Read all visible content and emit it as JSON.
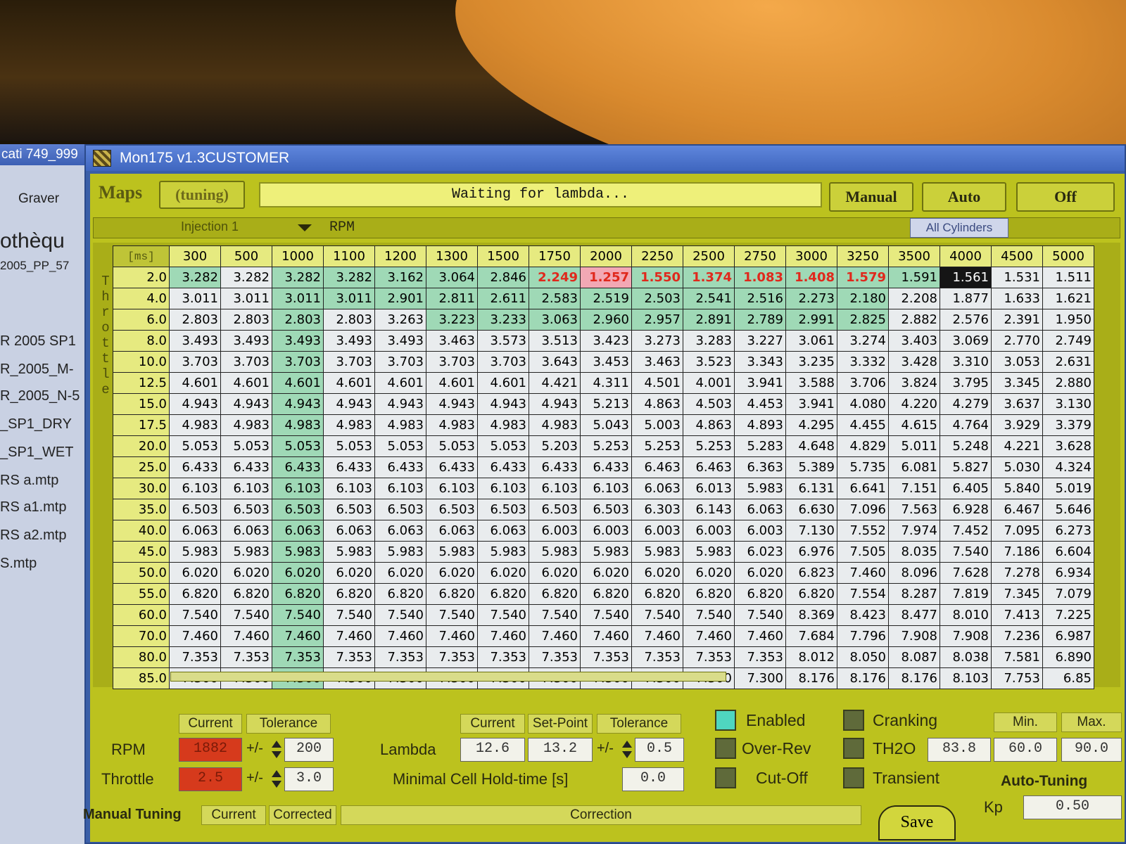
{
  "desktop": {
    "window_title": "cati 749_999",
    "items": [
      "Graver",
      "othèqu",
      "2005_PP_57",
      "R 2005 SP1",
      "R_2005_M-",
      "R_2005_N-5",
      "_SP1_DRY",
      "_SP1_WET",
      "RS a.mtp",
      "RS a1.mtp",
      "RS a2.mtp",
      "S.mtp"
    ]
  },
  "window": {
    "title": "Mon175 v1.3CUSTOMER"
  },
  "toolbar": {
    "maps_label": "Maps",
    "tuning_label": "(tuning)",
    "status_text": "Waiting for lambda...",
    "manual_label": "Manual",
    "auto_label": "Auto",
    "off_label": "Off"
  },
  "selector": {
    "injection_value": "Injection 1",
    "x_axis_label": "RPM",
    "cylinders_value": "All Cylinders"
  },
  "map": {
    "corner_label": "[ms]",
    "y_axis_label": "Throttle",
    "columns": [
      "300",
      "500",
      "1000",
      "1100",
      "1200",
      "1300",
      "1500",
      "1750",
      "2000",
      "2250",
      "2500",
      "2750",
      "3000",
      "3250",
      "3500",
      "4000",
      "4500",
      "5000"
    ],
    "rows": [
      {
        "label": "2.0",
        "values": [
          "3.282",
          "3.282",
          "3.282",
          "3.282",
          "3.162",
          "3.064",
          "2.846",
          "2.249",
          "1.257",
          "1.550",
          "1.374",
          "1.083",
          "1.408",
          "1.579",
          "1.591",
          "1.561",
          "1.531",
          "1.511"
        ]
      },
      {
        "label": "4.0",
        "values": [
          "3.011",
          "3.011",
          "3.011",
          "3.011",
          "2.901",
          "2.811",
          "2.611",
          "2.583",
          "2.519",
          "2.503",
          "2.541",
          "2.516",
          "2.273",
          "2.180",
          "2.208",
          "1.877",
          "1.633",
          "1.621"
        ]
      },
      {
        "label": "6.0",
        "values": [
          "2.803",
          "2.803",
          "2.803",
          "2.803",
          "3.263",
          "3.223",
          "3.233",
          "3.063",
          "2.960",
          "2.957",
          "2.891",
          "2.789",
          "2.991",
          "2.825",
          "2.882",
          "2.576",
          "2.391",
          "1.950"
        ]
      },
      {
        "label": "8.0",
        "values": [
          "3.493",
          "3.493",
          "3.493",
          "3.493",
          "3.493",
          "3.463",
          "3.573",
          "3.513",
          "3.423",
          "3.273",
          "3.283",
          "3.227",
          "3.061",
          "3.274",
          "3.403",
          "3.069",
          "2.770",
          "2.749"
        ]
      },
      {
        "label": "10.0",
        "values": [
          "3.703",
          "3.703",
          "3.703",
          "3.703",
          "3.703",
          "3.703",
          "3.703",
          "3.643",
          "3.453",
          "3.463",
          "3.523",
          "3.343",
          "3.235",
          "3.332",
          "3.428",
          "3.310",
          "3.053",
          "2.631"
        ]
      },
      {
        "label": "12.5",
        "values": [
          "4.601",
          "4.601",
          "4.601",
          "4.601",
          "4.601",
          "4.601",
          "4.601",
          "4.421",
          "4.311",
          "4.501",
          "4.001",
          "3.941",
          "3.588",
          "3.706",
          "3.824",
          "3.795",
          "3.345",
          "2.880"
        ]
      },
      {
        "label": "15.0",
        "values": [
          "4.943",
          "4.943",
          "4.943",
          "4.943",
          "4.943",
          "4.943",
          "4.943",
          "4.943",
          "5.213",
          "4.863",
          "4.503",
          "4.453",
          "3.941",
          "4.080",
          "4.220",
          "4.279",
          "3.637",
          "3.130"
        ]
      },
      {
        "label": "17.5",
        "values": [
          "4.983",
          "4.983",
          "4.983",
          "4.983",
          "4.983",
          "4.983",
          "4.983",
          "4.983",
          "5.043",
          "5.003",
          "4.863",
          "4.893",
          "4.295",
          "4.455",
          "4.615",
          "4.764",
          "3.929",
          "3.379"
        ]
      },
      {
        "label": "20.0",
        "values": [
          "5.053",
          "5.053",
          "5.053",
          "5.053",
          "5.053",
          "5.053",
          "5.053",
          "5.203",
          "5.253",
          "5.253",
          "5.253",
          "5.283",
          "4.648",
          "4.829",
          "5.011",
          "5.248",
          "4.221",
          "3.628"
        ]
      },
      {
        "label": "25.0",
        "values": [
          "6.433",
          "6.433",
          "6.433",
          "6.433",
          "6.433",
          "6.433",
          "6.433",
          "6.433",
          "6.433",
          "6.463",
          "6.463",
          "6.363",
          "5.389",
          "5.735",
          "6.081",
          "5.827",
          "5.030",
          "4.324"
        ]
      },
      {
        "label": "30.0",
        "values": [
          "6.103",
          "6.103",
          "6.103",
          "6.103",
          "6.103",
          "6.103",
          "6.103",
          "6.103",
          "6.103",
          "6.063",
          "6.013",
          "5.983",
          "6.131",
          "6.641",
          "7.151",
          "6.405",
          "5.840",
          "5.019"
        ]
      },
      {
        "label": "35.0",
        "values": [
          "6.503",
          "6.503",
          "6.503",
          "6.503",
          "6.503",
          "6.503",
          "6.503",
          "6.503",
          "6.503",
          "6.303",
          "6.143",
          "6.063",
          "6.630",
          "7.096",
          "7.563",
          "6.928",
          "6.467",
          "5.646"
        ]
      },
      {
        "label": "40.0",
        "values": [
          "6.063",
          "6.063",
          "6.063",
          "6.063",
          "6.063",
          "6.063",
          "6.063",
          "6.003",
          "6.003",
          "6.003",
          "6.003",
          "6.003",
          "7.130",
          "7.552",
          "7.974",
          "7.452",
          "7.095",
          "6.273"
        ]
      },
      {
        "label": "45.0",
        "values": [
          "5.983",
          "5.983",
          "5.983",
          "5.983",
          "5.983",
          "5.983",
          "5.983",
          "5.983",
          "5.983",
          "5.983",
          "5.983",
          "6.023",
          "6.976",
          "7.505",
          "8.035",
          "7.540",
          "7.186",
          "6.604"
        ]
      },
      {
        "label": "50.0",
        "values": [
          "6.020",
          "6.020",
          "6.020",
          "6.020",
          "6.020",
          "6.020",
          "6.020",
          "6.020",
          "6.020",
          "6.020",
          "6.020",
          "6.020",
          "6.823",
          "7.460",
          "8.096",
          "7.628",
          "7.278",
          "6.934"
        ]
      },
      {
        "label": "55.0",
        "values": [
          "6.820",
          "6.820",
          "6.820",
          "6.820",
          "6.820",
          "6.820",
          "6.820",
          "6.820",
          "6.820",
          "6.820",
          "6.820",
          "6.820",
          "6.820",
          "7.554",
          "8.287",
          "7.819",
          "7.345",
          "7.079"
        ]
      },
      {
        "label": "60.0",
        "values": [
          "7.540",
          "7.540",
          "7.540",
          "7.540",
          "7.540",
          "7.540",
          "7.540",
          "7.540",
          "7.540",
          "7.540",
          "7.540",
          "7.540",
          "8.369",
          "8.423",
          "8.477",
          "8.010",
          "7.413",
          "7.225"
        ]
      },
      {
        "label": "70.0",
        "values": [
          "7.460",
          "7.460",
          "7.460",
          "7.460",
          "7.460",
          "7.460",
          "7.460",
          "7.460",
          "7.460",
          "7.460",
          "7.460",
          "7.460",
          "7.684",
          "7.796",
          "7.908",
          "7.908",
          "7.236",
          "6.987"
        ]
      },
      {
        "label": "80.0",
        "values": [
          "7.353",
          "7.353",
          "7.353",
          "7.353",
          "7.353",
          "7.353",
          "7.353",
          "7.353",
          "7.353",
          "7.353",
          "7.353",
          "7.353",
          "8.012",
          "8.050",
          "8.087",
          "8.038",
          "7.581",
          "6.890"
        ]
      },
      {
        "label": "85.0",
        "values": [
          "7.300",
          "7.300",
          "7.300",
          "7.300",
          "7.300",
          "7.300",
          "7.300",
          "7.300",
          "7.300",
          "7.300",
          "7.300",
          "7.300",
          "8.176",
          "8.176",
          "8.176",
          "8.103",
          "7.753",
          "6.85"
        ]
      }
    ],
    "highlight": {
      "selected_cell": [
        0,
        15
      ],
      "red_text_cells": [
        [
          0,
          7
        ],
        [
          0,
          8
        ],
        [
          0,
          9
        ],
        [
          0,
          10
        ],
        [
          0,
          11
        ],
        [
          0,
          12
        ],
        [
          0,
          13
        ]
      ],
      "pink_cells": [
        [
          0,
          8
        ]
      ],
      "green_cells": [
        [
          0,
          0
        ],
        [
          0,
          2
        ],
        [
          0,
          3
        ],
        [
          0,
          4
        ],
        [
          0,
          5
        ],
        [
          0,
          6
        ],
        [
          0,
          7
        ],
        [
          0,
          9
        ],
        [
          0,
          10
        ],
        [
          0,
          11
        ],
        [
          0,
          12
        ],
        [
          0,
          13
        ],
        [
          0,
          14
        ],
        [
          1,
          2
        ],
        [
          1,
          3
        ],
        [
          1,
          4
        ],
        [
          1,
          5
        ],
        [
          1,
          6
        ],
        [
          1,
          7
        ],
        [
          1,
          8
        ],
        [
          1,
          9
        ],
        [
          1,
          10
        ],
        [
          1,
          11
        ],
        [
          1,
          12
        ],
        [
          1,
          13
        ],
        [
          2,
          2
        ],
        [
          2,
          5
        ],
        [
          2,
          6
        ],
        [
          2,
          7
        ],
        [
          2,
          8
        ],
        [
          2,
          9
        ],
        [
          2,
          10
        ],
        [
          2,
          11
        ],
        [
          2,
          12
        ],
        [
          2,
          13
        ],
        [
          3,
          2
        ],
        [
          4,
          2
        ],
        [
          5,
          2
        ],
        [
          6,
          2
        ],
        [
          7,
          2
        ],
        [
          8,
          2
        ],
        [
          9,
          2
        ],
        [
          10,
          2
        ],
        [
          11,
          2
        ],
        [
          12,
          2
        ],
        [
          13,
          2
        ],
        [
          14,
          2
        ],
        [
          15,
          2
        ],
        [
          16,
          2
        ],
        [
          17,
          2
        ],
        [
          18,
          2
        ],
        [
          19,
          2
        ]
      ]
    }
  },
  "bottom": {
    "rpm_label": "RPM",
    "throttle_label": "Throttle",
    "current_header": "Current",
    "tolerance_header": "Tolerance",
    "pm": "+/-",
    "rpm_current": "1882",
    "rpm_tolerance": "200",
    "throttle_current": "2.5",
    "throttle_tolerance": "3.0",
    "lambda_label": "Lambda",
    "lambda_current_header": "Current",
    "setpoint_header": "Set-Point",
    "lambda_tolerance_header": "Tolerance",
    "lambda_current": "12.6",
    "lambda_setpoint": "13.2",
    "lambda_tolerance": "0.5",
    "hold_label": "Minimal Cell Hold-time [s]",
    "hold_value": "0.0",
    "enabled_label": "Enabled",
    "overrev_label": "Over-Rev",
    "cutoff_label": "Cut-Off",
    "cranking_label": "Cranking",
    "th2o_label": "TH2O",
    "transient_label": "Transient",
    "th2o_value": "83.8",
    "min_header": "Min.",
    "max_header": "Max.",
    "min_value": "60.0",
    "max_value": "90.0",
    "autotuning_label": "Auto-Tuning",
    "kp_label": "Kp",
    "kp_value": "0.50",
    "manual_tuning_label": "Manual Tuning",
    "mt_current_header": "Current",
    "mt_corrected_header": "Corrected",
    "correction_header": "Correction",
    "save_label": "Save"
  },
  "colors": {
    "panel_yellow": "#bcc21e",
    "cell_green": "#9fd9b6",
    "warning_red": "#d63a1c",
    "selected_black": "#151515"
  }
}
